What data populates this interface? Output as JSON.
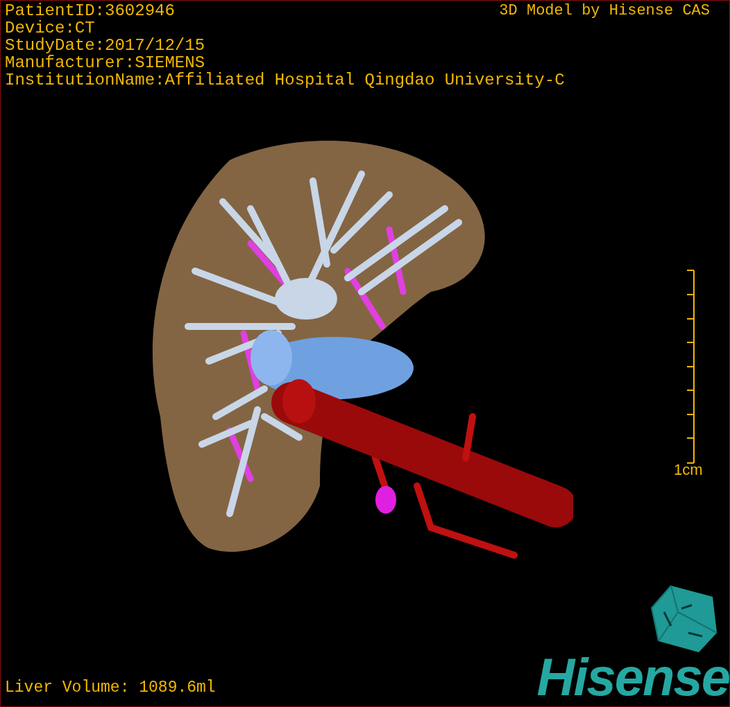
{
  "info_lines": [
    "PatientID:3602946",
    "Device:CT",
    "StudyDate:2017/12/15",
    "Manufacturer:SIEMENS",
    "InstitutionName:Affiliated Hospital Qingdao University-C"
  ],
  "title": "3D Model by Hisense CAS",
  "scale_label": "1cm",
  "volume": "Liver Volume: 1089.6ml",
  "logo": {
    "text": "Hisense"
  }
}
